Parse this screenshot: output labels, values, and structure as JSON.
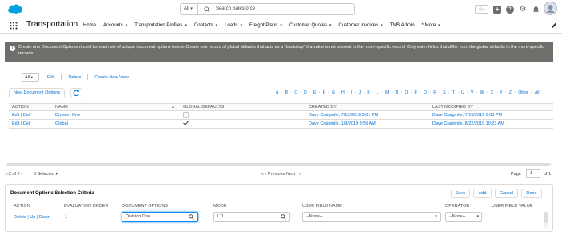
{
  "header": {
    "search_scope": "All",
    "search_placeholder": "Search Salesforce",
    "icons": [
      "favorite-star-icon",
      "add-icon",
      "help-icon",
      "setup-gear-icon",
      "notification-bell-icon",
      "avatar"
    ]
  },
  "nav": {
    "app_name": "Transportation",
    "items": [
      {
        "label": "Home",
        "chevron": false
      },
      {
        "label": "Accounts",
        "chevron": true
      },
      {
        "label": "Transportation Profiles",
        "chevron": true
      },
      {
        "label": "Contacts",
        "chevron": true
      },
      {
        "label": "Loads",
        "chevron": true
      },
      {
        "label": "Freight Plans",
        "chevron": true
      },
      {
        "label": "Customer Quotes",
        "chevron": true
      },
      {
        "label": "Customer Invoices",
        "chevron": true
      },
      {
        "label": "TMS Admin",
        "chevron": false
      },
      {
        "label": "* More",
        "chevron": true
      }
    ]
  },
  "banner": {
    "text": "Create one Document Options record for each set of unique document options below. Create one record of global defaults that acts as a \"backstop\" if a value is not present in the more-specific record. Only enter fields that differ from the global defaults in the more-specific records."
  },
  "view": {
    "selected": "All",
    "links": [
      "Edit",
      "Delete",
      "Create New View"
    ]
  },
  "toolbar": {
    "new_button": "New Document Options"
  },
  "alphabet": [
    "A",
    "B",
    "C",
    "D",
    "E",
    "F",
    "G",
    "H",
    "I",
    "J",
    "K",
    "L",
    "M",
    "N",
    "O",
    "P",
    "Q",
    "R",
    "S",
    "T",
    "U",
    "V",
    "W",
    "X",
    "Y",
    "Z",
    "Other",
    "All"
  ],
  "grid": {
    "columns": [
      "Action",
      "Name",
      "Global Defaults",
      "Created By",
      "Last Modified By"
    ],
    "rows": [
      {
        "action": "Edit | Del",
        "name": "Division One",
        "global": false,
        "created": "Dave Craigmile, 7/15/2019 3:01 PM",
        "modified": "Dave Craigmile, 7/15/2019 3:03 PM"
      },
      {
        "action": "Edit | Del",
        "name": "Global",
        "global": true,
        "created": "Dave Craigmile, 1/3/2019 9:56 AM",
        "modified": "Dave Craigmile, 8/22/2019 10:23 AM"
      }
    ]
  },
  "pager": {
    "count": "1-2 of 2",
    "selected": "0 Selected",
    "nav": "« ‹ Previous Next › »",
    "page_label": "Page",
    "page_value": "1",
    "of_label": "of 1"
  },
  "criteria": {
    "title": "Document Options Selection Criteria",
    "buttons": [
      "Save",
      "Add",
      "Cancel",
      "Done"
    ],
    "columns": [
      "Action",
      "Evaluation Order",
      "Document Options",
      "Mode",
      "User Field Name",
      "Operator",
      "User Field Value"
    ],
    "row": {
      "action": "Delete | Up | Down",
      "order": "1",
      "document_options": "Division One",
      "mode": "LTL",
      "user_field_name": "--None--",
      "operator": "--None--"
    }
  },
  "colors": {
    "link": "#0070d2",
    "banner": "#706e6b",
    "brand": "#00a1e0"
  }
}
